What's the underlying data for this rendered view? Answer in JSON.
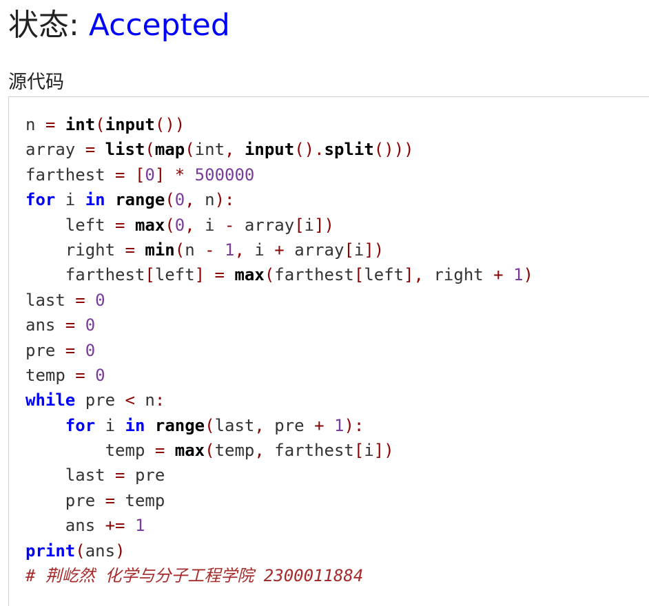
{
  "status": {
    "label": "状态: ",
    "value": "Accepted"
  },
  "section": {
    "title": "源代码"
  },
  "code_lines": [
    [
      [
        "id",
        "n "
      ],
      [
        "op",
        "="
      ],
      [
        "id",
        " "
      ],
      [
        "fn",
        "int"
      ],
      [
        "op",
        "("
      ],
      [
        "fn",
        "input"
      ],
      [
        "op",
        "())"
      ]
    ],
    [
      [
        "id",
        "array "
      ],
      [
        "op",
        "="
      ],
      [
        "id",
        " "
      ],
      [
        "fn",
        "list"
      ],
      [
        "op",
        "("
      ],
      [
        "fn",
        "map"
      ],
      [
        "op",
        "("
      ],
      [
        "id",
        "int"
      ],
      [
        "op",
        ","
      ],
      [
        "id",
        " "
      ],
      [
        "fn",
        "input"
      ],
      [
        "op",
        "()."
      ],
      [
        "fn",
        "split"
      ],
      [
        "op",
        "()))"
      ]
    ],
    [
      [
        "id",
        "farthest "
      ],
      [
        "op",
        "="
      ],
      [
        "id",
        " "
      ],
      [
        "op",
        "["
      ],
      [
        "num",
        "0"
      ],
      [
        "op",
        "]"
      ],
      [
        "id",
        " "
      ],
      [
        "op",
        "*"
      ],
      [
        "id",
        " "
      ],
      [
        "num",
        "500000"
      ]
    ],
    [
      [
        "kw",
        "for"
      ],
      [
        "id",
        " i "
      ],
      [
        "kw",
        "in"
      ],
      [
        "id",
        " "
      ],
      [
        "fn",
        "range"
      ],
      [
        "op",
        "("
      ],
      [
        "num",
        "0"
      ],
      [
        "op",
        ","
      ],
      [
        "id",
        " n"
      ],
      [
        "op",
        "):"
      ]
    ],
    [
      [
        "id",
        "    left "
      ],
      [
        "op",
        "="
      ],
      [
        "id",
        " "
      ],
      [
        "fn",
        "max"
      ],
      [
        "op",
        "("
      ],
      [
        "num",
        "0"
      ],
      [
        "op",
        ","
      ],
      [
        "id",
        " i "
      ],
      [
        "op",
        "-"
      ],
      [
        "id",
        " array"
      ],
      [
        "op",
        "["
      ],
      [
        "id",
        "i"
      ],
      [
        "op",
        "])"
      ]
    ],
    [
      [
        "id",
        "    right "
      ],
      [
        "op",
        "="
      ],
      [
        "id",
        " "
      ],
      [
        "fn",
        "min"
      ],
      [
        "op",
        "("
      ],
      [
        "id",
        "n "
      ],
      [
        "op",
        "-"
      ],
      [
        "id",
        " "
      ],
      [
        "num",
        "1"
      ],
      [
        "op",
        ","
      ],
      [
        "id",
        " i "
      ],
      [
        "op",
        "+"
      ],
      [
        "id",
        " array"
      ],
      [
        "op",
        "["
      ],
      [
        "id",
        "i"
      ],
      [
        "op",
        "])"
      ]
    ],
    [
      [
        "id",
        "    farthest"
      ],
      [
        "op",
        "["
      ],
      [
        "id",
        "left"
      ],
      [
        "op",
        "]"
      ],
      [
        "id",
        " "
      ],
      [
        "op",
        "="
      ],
      [
        "id",
        " "
      ],
      [
        "fn",
        "max"
      ],
      [
        "op",
        "("
      ],
      [
        "id",
        "farthest"
      ],
      [
        "op",
        "["
      ],
      [
        "id",
        "left"
      ],
      [
        "op",
        "],"
      ],
      [
        "id",
        " right "
      ],
      [
        "op",
        "+"
      ],
      [
        "id",
        " "
      ],
      [
        "num",
        "1"
      ],
      [
        "op",
        ")"
      ]
    ],
    [
      [
        "id",
        "last "
      ],
      [
        "op",
        "="
      ],
      [
        "id",
        " "
      ],
      [
        "num",
        "0"
      ]
    ],
    [
      [
        "id",
        "ans "
      ],
      [
        "op",
        "="
      ],
      [
        "id",
        " "
      ],
      [
        "num",
        "0"
      ]
    ],
    [
      [
        "id",
        "pre "
      ],
      [
        "op",
        "="
      ],
      [
        "id",
        " "
      ],
      [
        "num",
        "0"
      ]
    ],
    [
      [
        "id",
        "temp "
      ],
      [
        "op",
        "="
      ],
      [
        "id",
        " "
      ],
      [
        "num",
        "0"
      ]
    ],
    [
      [
        "kw",
        "while"
      ],
      [
        "id",
        " pre "
      ],
      [
        "op",
        "<"
      ],
      [
        "id",
        " n"
      ],
      [
        "op",
        ":"
      ]
    ],
    [
      [
        "id",
        "    "
      ],
      [
        "kw",
        "for"
      ],
      [
        "id",
        " i "
      ],
      [
        "kw",
        "in"
      ],
      [
        "id",
        " "
      ],
      [
        "fn",
        "range"
      ],
      [
        "op",
        "("
      ],
      [
        "id",
        "last"
      ],
      [
        "op",
        ","
      ],
      [
        "id",
        " pre "
      ],
      [
        "op",
        "+"
      ],
      [
        "id",
        " "
      ],
      [
        "num",
        "1"
      ],
      [
        "op",
        "):"
      ]
    ],
    [
      [
        "id",
        "        temp "
      ],
      [
        "op",
        "="
      ],
      [
        "id",
        " "
      ],
      [
        "fn",
        "max"
      ],
      [
        "op",
        "("
      ],
      [
        "id",
        "temp"
      ],
      [
        "op",
        ","
      ],
      [
        "id",
        " farthest"
      ],
      [
        "op",
        "["
      ],
      [
        "id",
        "i"
      ],
      [
        "op",
        "])"
      ]
    ],
    [
      [
        "id",
        "    last "
      ],
      [
        "op",
        "="
      ],
      [
        "id",
        " pre"
      ]
    ],
    [
      [
        "id",
        "    pre "
      ],
      [
        "op",
        "="
      ],
      [
        "id",
        " temp"
      ]
    ],
    [
      [
        "id",
        "    ans "
      ],
      [
        "op",
        "+="
      ],
      [
        "id",
        " "
      ],
      [
        "num",
        "1"
      ]
    ],
    [
      [
        "kw",
        "print"
      ],
      [
        "op",
        "("
      ],
      [
        "id",
        "ans"
      ],
      [
        "op",
        ")"
      ]
    ],
    [
      [
        "comment",
        "# 荆屹然 化学与分子工程学院 2300011884"
      ]
    ]
  ]
}
